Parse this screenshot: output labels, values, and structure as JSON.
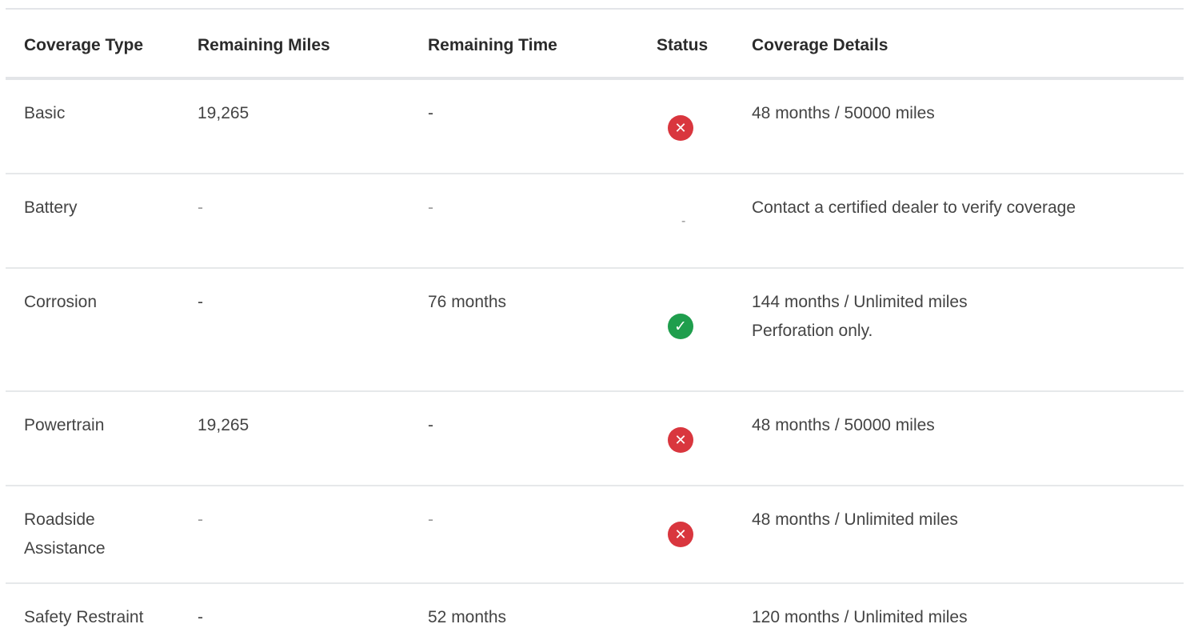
{
  "headers": {
    "type": "Coverage Type",
    "miles": "Remaining Miles",
    "time": "Remaining Time",
    "status": "Status",
    "details": "Coverage Details"
  },
  "rows": [
    {
      "type": "Basic",
      "miles": "19,265",
      "time": "-",
      "status": "expired",
      "details": [
        "48 months / 50000 miles"
      ]
    },
    {
      "type": "Battery",
      "miles": "-",
      "time": "-",
      "status": "-",
      "details": [
        "Contact a certified dealer to verify coverage"
      ]
    },
    {
      "type": "Corrosion",
      "miles": "-",
      "time": "76 months",
      "status": "active",
      "details": [
        "144 months / Unlimited miles",
        "Perforation only."
      ]
    },
    {
      "type": "Powertrain",
      "miles": "19,265",
      "time": "-",
      "status": "expired",
      "details": [
        "48 months / 50000 miles"
      ]
    },
    {
      "type": "Roadside Assistance",
      "miles": "-",
      "time": "-",
      "status": "expired",
      "details": [
        "48 months / Unlimited miles"
      ]
    },
    {
      "type": "Safety Restraint",
      "miles": "-",
      "time": "52 months",
      "status": "",
      "details": [
        "120 months / Unlimited miles"
      ]
    }
  ],
  "icons": {
    "expired": "x-circle-icon",
    "active": "check-circle-icon"
  },
  "colors": {
    "expired": "#d9363e",
    "active": "#1f9e4d"
  }
}
